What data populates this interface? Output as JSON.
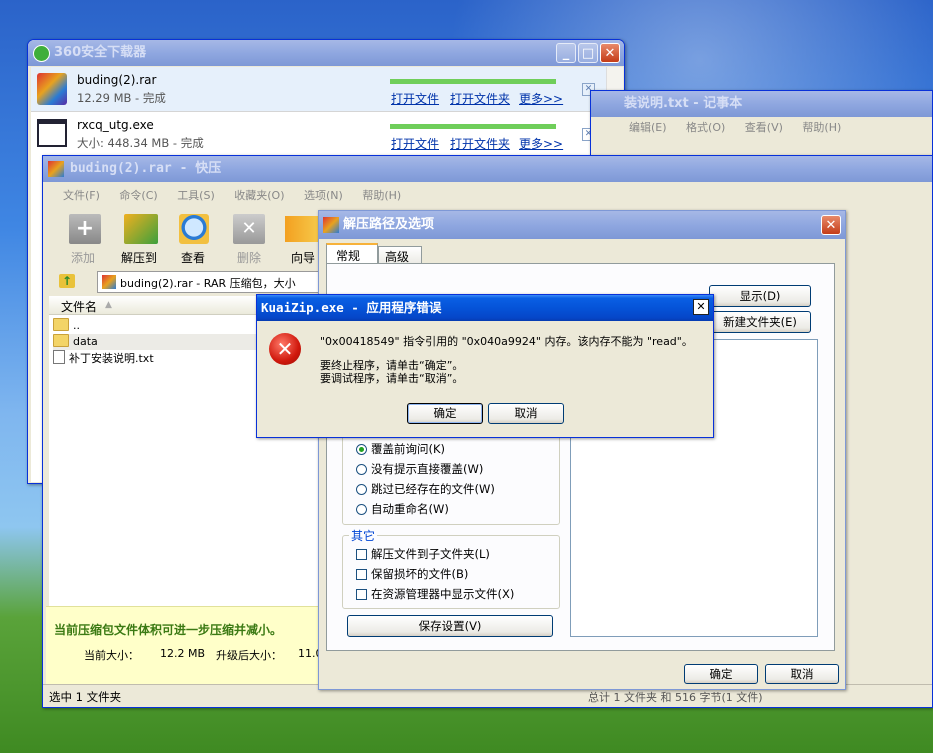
{
  "downloader": {
    "title": "360安全下载器",
    "items": [
      {
        "name": "buding(2).rar",
        "info": "12.29 MB - 完成",
        "open_file": "打开文件",
        "open_folder": "打开文件夹",
        "more": "更多>>"
      },
      {
        "name": "rxcq_utg.exe",
        "info": "大小: 448.34 MB - 完成",
        "open_file": "打开文件",
        "open_folder": "打开文件夹",
        "more": "更多>>"
      }
    ]
  },
  "notepad": {
    "title": "装说明.txt - 记事本",
    "menu": [
      "编辑(E)",
      "格式(O)",
      "查看(V)",
      "帮助(H)"
    ]
  },
  "kuaiya": {
    "title": "buding(2).rar - 快压",
    "menu": [
      "文件(F)",
      "命令(C)",
      "工具(S)",
      "收藏夹(O)",
      "选项(N)",
      "帮助(H)"
    ],
    "toolbar": [
      "添加",
      "解压到",
      "查看",
      "删除",
      "向导"
    ],
    "path_text": "buding(2).rar - RAR 压缩包，大小",
    "column_name": "文件名",
    "files": [
      "..",
      "data",
      "补丁安装说明.txt"
    ],
    "promo": "当前压缩包文件体积可进一步压缩并减小。",
    "current_size_label": "当前大小：",
    "current_size": "12.2 MB",
    "upgraded_label": "升级后大小：",
    "upgraded_size": "11.0",
    "status_left": "选中 1 文件夹",
    "status_right": "总计 1 文件夹 和 516 字节(1 文件)"
  },
  "extract": {
    "title": "解压路径及选项",
    "tabs": [
      "常规",
      "高级"
    ],
    "show_button": "显示(D)",
    "new_folder_button": "新建文件夹(E)",
    "overwrite": [
      "覆盖前询问(K)",
      "没有提示直接覆盖(W)",
      "跳过已经存在的文件(W)",
      "自动重命名(W)"
    ],
    "other_group": "其它",
    "other": [
      "解压文件到子文件夹(L)",
      "保留损坏的文件(B)",
      "在资源管理器中显示文件(X)"
    ],
    "save_button": "保存设置(V)",
    "ok": "确定",
    "cancel": "取消"
  },
  "error": {
    "title": "KuaiZip.exe - 应用程序错误",
    "line1": "\"0x00418549\" 指令引用的 \"0x040a9924\" 内存。该内存不能为 \"read\"。",
    "line2": "要终止程序，请单击“确定”。",
    "line3": "要调试程序，请单击“取消”。",
    "ok": "确定",
    "cancel": "取消"
  }
}
